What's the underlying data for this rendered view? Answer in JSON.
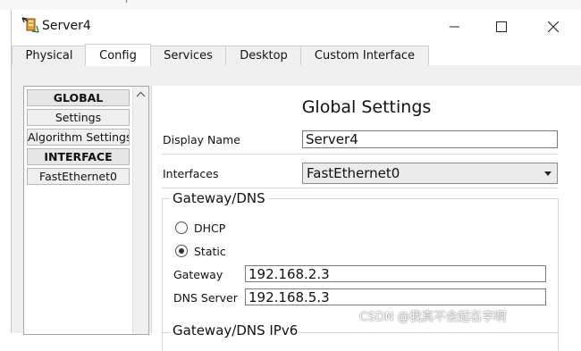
{
  "window": {
    "title": "Server4"
  },
  "tabs": [
    {
      "label": "Physical",
      "active": false
    },
    {
      "label": "Config",
      "active": true
    },
    {
      "label": "Services",
      "active": false
    },
    {
      "label": "Desktop",
      "active": false
    },
    {
      "label": "Custom Interface",
      "active": false
    }
  ],
  "sidebar": {
    "items": [
      {
        "label": "GLOBAL",
        "header": true
      },
      {
        "label": "Settings",
        "header": false
      },
      {
        "label": "Algorithm Settings",
        "header": false
      },
      {
        "label": "INTERFACE",
        "header": true
      },
      {
        "label": "FastEthernet0",
        "header": false
      }
    ]
  },
  "global_settings": {
    "title": "Global Settings",
    "display_name_label": "Display Name",
    "display_name_value": "Server4",
    "interfaces_label": "Interfaces",
    "interfaces_value": "FastEthernet0",
    "gateway_dns": {
      "title": "Gateway/DNS",
      "dhcp_label": "DHCP",
      "static_label": "Static",
      "selected": "Static",
      "gateway_label": "Gateway",
      "gateway_value": "192.168.2.3",
      "dns_label": "DNS Server",
      "dns_value": "192.168.5.3"
    },
    "gateway_dns_ipv6": {
      "title": "Gateway/DNS IPv6"
    }
  },
  "watermark": "CSDN @我真不会起名字啊",
  "colors": {
    "content_bg": "#f0f0f0",
    "border": "#cfcfcf"
  }
}
